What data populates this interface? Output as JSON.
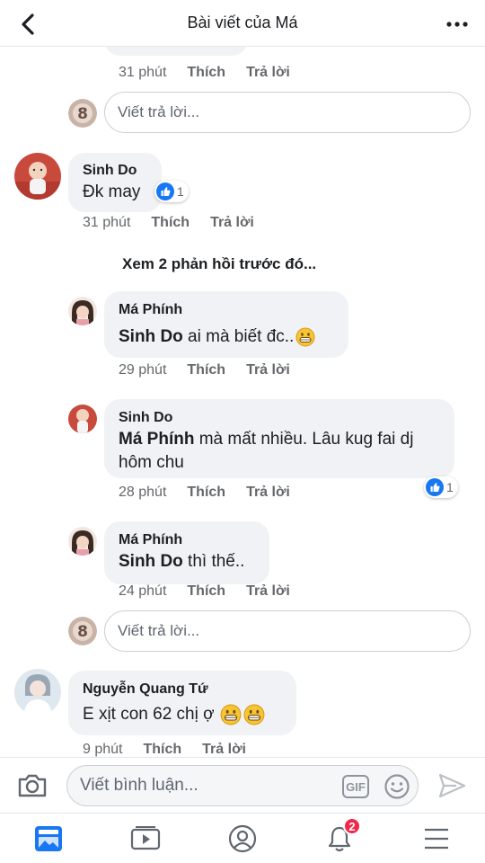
{
  "header": {
    "title": "Bài viết của Má"
  },
  "top_partial": {
    "time": "31 phút",
    "like": "Thích",
    "reply": "Trả lời"
  },
  "reply_placeholder": "Viết trả lời...",
  "comments": [
    {
      "name": "Sinh Do",
      "text": "Đk may",
      "time": "31 phút",
      "like": "Thích",
      "reply": "Trả lời",
      "reactions": "1"
    }
  ],
  "see_previous": "Xem 2 phản hồi trước đó...",
  "replies": [
    {
      "name": "Má Phính",
      "mention": "Sinh Do",
      "text": " ai mà biết đc..",
      "time": "29 phút",
      "like": "Thích",
      "reply": "Trả lời"
    },
    {
      "name": "Sinh Do",
      "mention": "Má Phính",
      "text": " mà mất nhiều. Lâu kug fai dj",
      "text2": "hôm chu",
      "time": "28 phút",
      "like": "Thích",
      "reply": "Trả lời",
      "reactions": "1"
    },
    {
      "name": "Má Phính",
      "mention": "Sinh Do",
      "text": " thì thế..",
      "time": "24 phút",
      "like": "Thích",
      "reply": "Trả lời"
    }
  ],
  "last_comment": {
    "name": "Nguyễn Quang Tứ",
    "text": "E xịt con 62 chị ợ",
    "time": "9 phút",
    "like": "Thích",
    "reply": "Trả lời"
  },
  "composer": {
    "placeholder": "Viết bình luận...",
    "gif_label": "GIF"
  },
  "tabbar": {
    "notifications_badge": "2"
  },
  "colors": {
    "like_blue": "#1877f2",
    "badge_red": "#f02849",
    "bubble_bg": "#f0f2f5",
    "meta_gray": "#65676b"
  }
}
